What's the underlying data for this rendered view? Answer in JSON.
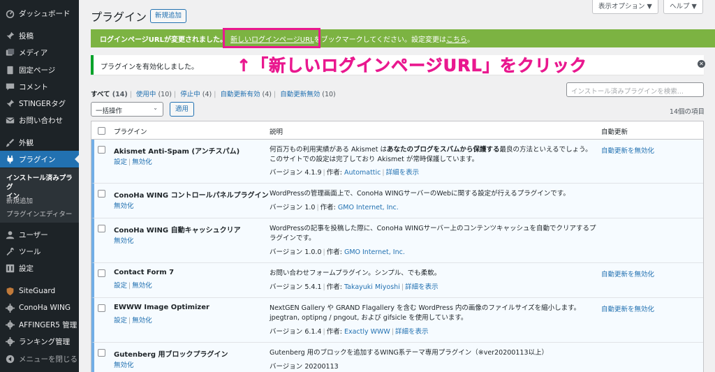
{
  "sidebar": {
    "items": [
      {
        "label": "ダッシュボード",
        "icon": "dashboard-icon"
      },
      {
        "label": "投稿",
        "icon": "pin-icon"
      },
      {
        "label": "メディア",
        "icon": "media-icon"
      },
      {
        "label": "固定ページ",
        "icon": "page-icon"
      },
      {
        "label": "コメント",
        "icon": "comment-icon"
      },
      {
        "label": "STINGERタグ",
        "icon": "pin-icon"
      },
      {
        "label": "お問い合わせ",
        "icon": "mail-icon"
      },
      {
        "label": "外観",
        "icon": "brush-icon"
      },
      {
        "label": "プラグイン",
        "icon": "plugin-icon"
      },
      {
        "label": "ユーザー",
        "icon": "user-icon"
      },
      {
        "label": "ツール",
        "icon": "wrench-icon"
      },
      {
        "label": "設定",
        "icon": "settings-icon"
      },
      {
        "label": "SiteGuard",
        "icon": "shield-icon"
      },
      {
        "label": "ConoHa WING",
        "icon": "gear-icon"
      },
      {
        "label": "AFFINGER5 管理",
        "icon": "gear-icon"
      },
      {
        "label": "ランキング管理",
        "icon": "gear-icon"
      },
      {
        "label": "メニューを閉じる",
        "icon": "collapse-icon"
      }
    ],
    "submenu": [
      "インストール済みプラグ",
      "イン",
      "新規追加",
      "プラグインエディター"
    ]
  },
  "header": {
    "title": "プラグイン",
    "add_new": "新規追加",
    "screen_options": "表示オプション ▼",
    "help": "ヘルプ ▼"
  },
  "notice_green": {
    "strong": "ログインページURLが変更されました。",
    "link": "新しいログインページURL",
    "rest": "をブックマークしてください。設定変更は",
    "here": "こちら",
    "end": "。"
  },
  "notice_activated": "プラグインを有効化しました。",
  "annotation": "↑「新しいログインページURL」をクリック",
  "filters": [
    {
      "label": "すべて",
      "count": "(14)"
    },
    {
      "label": "使用中",
      "count": "(10)"
    },
    {
      "label": "停止中",
      "count": "(4)"
    },
    {
      "label": "自動更新有効",
      "count": "(4)"
    },
    {
      "label": "自動更新無効",
      "count": "(10)"
    }
  ],
  "search_placeholder": "インストール済みプラグインを検索...",
  "bulk_action": "一括操作",
  "apply": "適用",
  "items_count": "14個の項目",
  "columns": {
    "plugin": "プラグイン",
    "description": "説明",
    "auto_update": "自動更新"
  },
  "plugins": [
    {
      "name": "Akismet Anti-Spam (アンチスパム)",
      "settings": "設定",
      "deactivate": "無効化",
      "desc_pre": "何百万もの利用実績がある Akismet は",
      "desc_bold": "あなたのブログをスパムから保護する",
      "desc_post": "最良の方法といえるでしょう。このサイトでの設定は完了しており Akismet が常時保護しています。",
      "version": "バージョン 4.1.9",
      "author_label": "作者:",
      "author": "Automattic",
      "details": "詳細を表示",
      "auto": "自動更新を無効化"
    },
    {
      "name": "ConoHa WING コントロールパネルプラグイン",
      "deactivate": "無効化",
      "desc": "WordPressの管理画面上で、ConoHa WINGサーバーのWebに関する設定が行えるプラグインです。",
      "version": "バージョン 1.0",
      "author_label": "作者:",
      "author": "GMO Internet, Inc."
    },
    {
      "name": "ConoHa WING 自動キャッシュクリア",
      "deactivate": "無効化",
      "desc": "WordPressの記事を投稿した際に、ConoHa WINGサーバー上のコンテンツキャッシュを自動でクリアするプラグインです。",
      "version": "バージョン 1.0.0",
      "author_label": "作者:",
      "author": "GMO Internet, Inc."
    },
    {
      "name": "Contact Form 7",
      "settings": "設定",
      "deactivate": "無効化",
      "desc": "お問い合わせフォームプラグイン。シンプル、でも柔軟。",
      "version": "バージョン 5.4.1",
      "author_label": "作者:",
      "author": "Takayuki Miyoshi",
      "details": "詳細を表示",
      "auto": "自動更新を無効化"
    },
    {
      "name": "EWWW Image Optimizer",
      "settings": "設定",
      "deactivate": "無効化",
      "desc": "NextGEN Gallery や GRAND Flagallery を含む WordPress 内の画像のファイルサイズを縮小します。 jpegtran, optipng / pngout, および gifsicle を使用しています。",
      "version": "バージョン 6.1.4",
      "author_label": "作者:",
      "author": "Exactly WWW",
      "details": "詳細を表示",
      "auto": "自動更新を無効化"
    },
    {
      "name": "Gutenberg 用ブロックプラグイン",
      "deactivate": "無効化",
      "desc": "Gutenberg 用のブロックを追加するWING系テーマ専用プラグイン（※ver20200113以上）",
      "version": "バージョン 20200113"
    }
  ]
}
